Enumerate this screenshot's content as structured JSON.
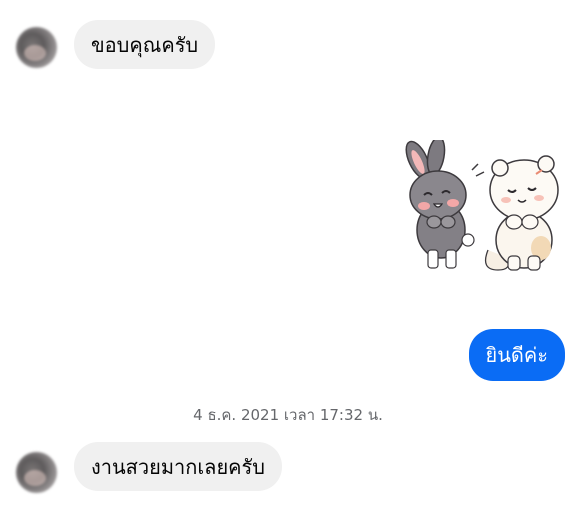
{
  "messages": [
    {
      "direction": "incoming",
      "text": "ขอบคุณครับ"
    },
    {
      "direction": "outgoing",
      "type": "sticker",
      "sticker": "bunny-and-bear-cheering"
    },
    {
      "direction": "outgoing",
      "text": "ยินดีค่ะ"
    }
  ],
  "timestamp": "4 ธ.ค. 2021 เวลา 17:32 น.",
  "messages_after": [
    {
      "direction": "incoming",
      "text": "งานสวยมากเลยครับ"
    }
  ],
  "colors": {
    "outgoing_bubble": "#0a6cf5",
    "incoming_bubble": "#f0f0f0",
    "timestamp_text": "#65676b"
  }
}
